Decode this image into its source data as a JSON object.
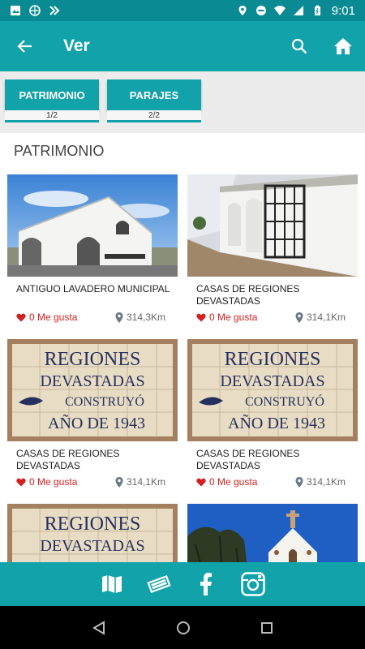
{
  "status_bar": {
    "time": "9:01"
  },
  "app_bar": {
    "title": "Ver"
  },
  "tabs": [
    {
      "label": "PATRIMONIO",
      "count": "1/2"
    },
    {
      "label": "PARAJES",
      "count": "2/2"
    }
  ],
  "section": {
    "title": "PATRIMONIO"
  },
  "cards": [
    {
      "title": "ANTIGUO LAVADERO MUNICIPAL",
      "likes": "0 Me gusta",
      "distance": "314,3Km",
      "image": "building-photo"
    },
    {
      "title": "CASAS DE REGIONES DEVASTADAS",
      "likes": "0 Me gusta",
      "distance": "314,1Km",
      "image": "street-photo"
    },
    {
      "title": "CASAS DE REGIONES DEVASTADAS",
      "likes": "0 Me gusta",
      "distance": "314,1Km",
      "image": "tile-sign-photo"
    },
    {
      "title": "CASAS DE REGIONES DEVASTADAS",
      "likes": "0 Me gusta",
      "distance": "314,1Km",
      "image": "tile-sign-photo"
    },
    {
      "title": "",
      "likes": "",
      "distance": "",
      "image": "tile-sign-photo"
    },
    {
      "title": "",
      "likes": "",
      "distance": "",
      "image": "chapel-photo"
    }
  ],
  "tile_sign": {
    "line1": "REGIONES",
    "line2": "DEVASTADAS",
    "line3": "CONSTRUYÓ",
    "line4": "AÑO DE 1943"
  },
  "colors": {
    "primary": "#12a2aa",
    "status": "#0a8b93",
    "like": "#d32020"
  }
}
